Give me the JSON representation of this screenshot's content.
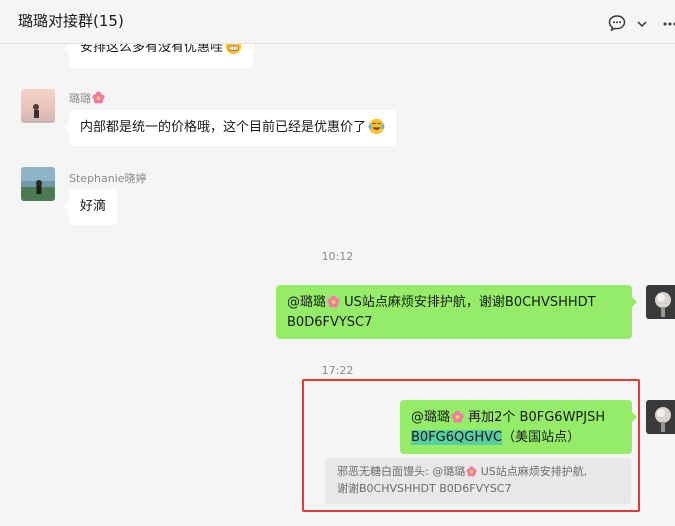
{
  "header": {
    "title": "璐璐对接群(15)",
    "icons": [
      "chat-bubble-icon",
      "chevron-down-icon",
      "more-icon"
    ]
  },
  "messages": [
    {
      "side": "left",
      "text": "安排这么多有没有优惠哇",
      "emoji": "grin-emoji"
    },
    {
      "side": "left",
      "sender": "璐璐",
      "text": "内部都是统一的价格哦，这个目前已经是优惠价了",
      "emoji": "laugh-tears-emoji"
    },
    {
      "side": "left",
      "sender": "Stephanie晓婷",
      "text": "好滴"
    }
  ],
  "times": [
    "10:12",
    "17:22"
  ],
  "my_msg1": {
    "mention": "@璐璐",
    "text1": " US站点麻烦安排护航，谢谢B0CHVSHHDT",
    "text2": "B0D6FVYSC7"
  },
  "my_msg2": {
    "mention": "@璐璐",
    "text1": " 再加2个 B0FG6WPJSH",
    "highlight": "B0FG6QGHVC",
    "text2": "（美国站点）",
    "quote_line1": "邪恶无糖白面馒头: @璐璐",
    "quote_line1b": " US站点麻烦安排护航,",
    "quote_line2": "谢谢B0CHVSHHDT B0D6FVYSC7"
  },
  "colors": {
    "my_bubble": "#95ec69",
    "highlight": "#56cfa3",
    "frame": "#e53935"
  }
}
